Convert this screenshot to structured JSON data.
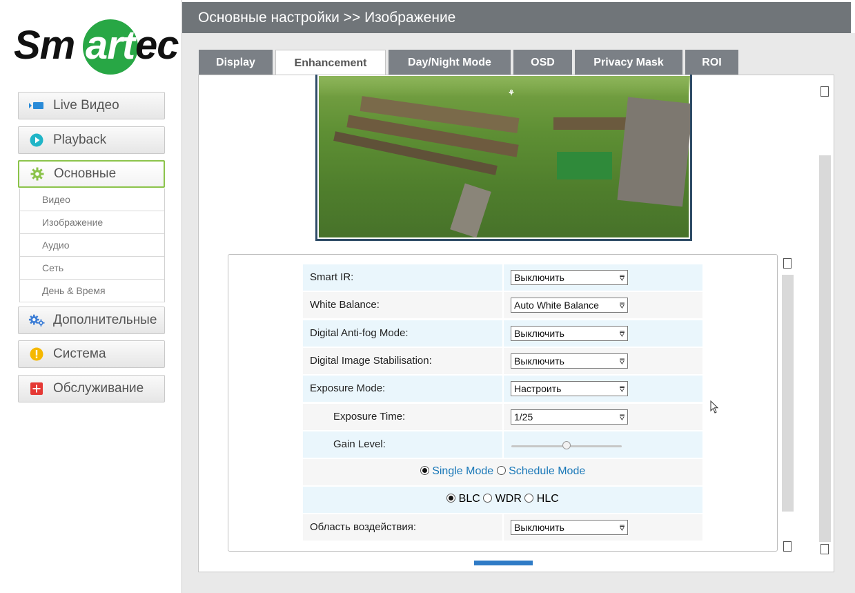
{
  "brand": {
    "logo_left": "Sm",
    "logo_mid": "art",
    "logo_right": "ec",
    "green": "#28a745"
  },
  "header": {
    "title": "Основные настройки >> Изображение"
  },
  "sidebar": {
    "nav": [
      {
        "label": "Live Видео",
        "icon": "live-video-icon"
      },
      {
        "label": "Playback",
        "icon": "playback-icon"
      },
      {
        "label": "Основные",
        "icon": "gear-icon",
        "active": true
      },
      {
        "label": "Дополнительные",
        "icon": "gears-icon"
      },
      {
        "label": "Система",
        "icon": "warning-icon"
      },
      {
        "label": "Обслуживание",
        "icon": "plus-square-icon"
      }
    ],
    "submenu": [
      "Видео",
      "Изображение",
      "Аудио",
      "Сеть",
      "День & Время"
    ]
  },
  "tabs": [
    {
      "label": "Display"
    },
    {
      "label": "Enhancement",
      "active": true
    },
    {
      "label": "Day/Night Mode"
    },
    {
      "label": "OSD"
    },
    {
      "label": "Privacy Mask"
    },
    {
      "label": "ROI"
    }
  ],
  "settings": {
    "smart_ir": {
      "label": "Smart IR:",
      "value": "Выключить"
    },
    "white_balance": {
      "label": "White Balance:",
      "value": "Auto White Balance"
    },
    "anti_fog": {
      "label": "Digital Anti-fog Mode:",
      "value": "Выключить"
    },
    "stabilisation": {
      "label": "Digital Image Stabilisation:",
      "value": "Выключить"
    },
    "exposure_mode": {
      "label": "Exposure Mode:",
      "value": "Настроить"
    },
    "exposure_time": {
      "label": "Exposure Time:",
      "value": "1/25"
    },
    "gain_level": {
      "label": "Gain Level:",
      "value_fraction": 0.5
    },
    "mode": {
      "single": "Single Mode",
      "schedule": "Schedule Mode",
      "selected": "single"
    },
    "backlight": {
      "blc": "BLC",
      "wdr": "WDR",
      "hlc": "HLC",
      "selected": "blc"
    },
    "area": {
      "label": "Область воздействия:",
      "value": "Выключить"
    }
  },
  "colors": {
    "header_bg": "#707579",
    "tab_bg": "#7b8086",
    "row_shade": "#eaf6fc",
    "link": "#1a78b8",
    "accent_bar": "#2f7bc6"
  }
}
